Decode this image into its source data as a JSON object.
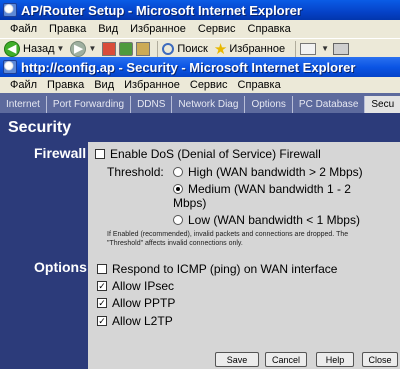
{
  "outer_window": {
    "title": "AP/Router Setup - Microsoft Internet Explorer",
    "menu": [
      "Файл",
      "Правка",
      "Вид",
      "Избранное",
      "Сервис",
      "Справка"
    ],
    "toolbar": {
      "back_label": "Назад",
      "search_label": "Поиск",
      "favorites_label": "Избранное"
    }
  },
  "inner_window": {
    "title": "http://config.ap - Security - Microsoft Internet Explorer",
    "menu": [
      "Файл",
      "Правка",
      "Вид",
      "Избранное",
      "Сервис",
      "Справка"
    ]
  },
  "tabs": [
    "Internet",
    "Port Forwarding",
    "DDNS",
    "Network Diag",
    "Options",
    "PC Database",
    "Secu"
  ],
  "page": {
    "title": "Security",
    "firewall": {
      "section_label": "Firewall",
      "dos_label": "Enable DoS (Denial of Service) Firewall",
      "dos_checked": false,
      "threshold_label": "Threshold:",
      "options": [
        {
          "label_line1": "High (WAN bandwidth > 2 Mbps)",
          "label_line2": "",
          "checked": false
        },
        {
          "label_line1": "Medium (WAN bandwidth 1 - 2",
          "label_line2": "Mbps)",
          "checked": true
        },
        {
          "label_line1": "Low (WAN bandwidth < 1 Mbps)",
          "label_line2": "",
          "checked": false
        }
      ],
      "note": "If Enabled (recommended), invalid packets and connections are dropped. The \"Threshold\" affects invalid connections only."
    },
    "options": {
      "section_label": "Options",
      "items": [
        {
          "label": "Respond to ICMP (ping) on WAN interface",
          "checked": false
        },
        {
          "label": "Allow IPsec",
          "checked": true
        },
        {
          "label": "Allow PPTP",
          "checked": true
        },
        {
          "label": "Allow L2TP",
          "checked": true
        }
      ]
    },
    "buttons": {
      "save": "Save",
      "cancel": "Cancel",
      "help": "Help",
      "close": "Close"
    }
  },
  "colors": {
    "page_bg": "#2c3b7a",
    "panel_bg": "#d6d6d6",
    "titlebar": "#0b55e4"
  }
}
